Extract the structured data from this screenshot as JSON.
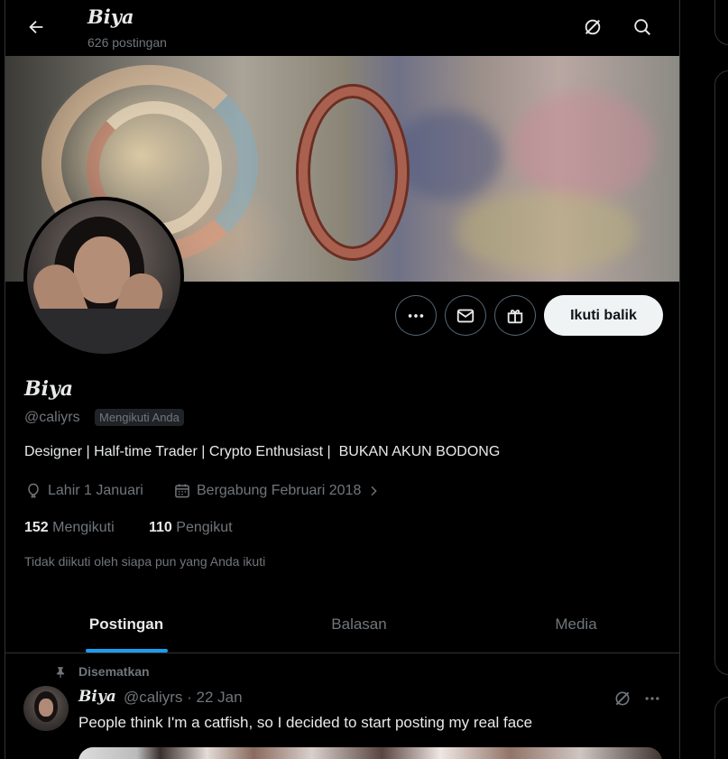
{
  "header": {
    "title": "Biya",
    "post_count": "626 postingan"
  },
  "profile": {
    "name": "Biya",
    "handle": "@caliyrs",
    "follows_you_badge": "Mengikuti Anda",
    "bio": "Designer | Half-time Trader | Crypto Enthusiast |  BUKAN AKUN BODONG",
    "birthday": "Lahir 1 Januari",
    "joined": "Bergabung Februari 2018",
    "following_count": "152",
    "following_label": "Mengikuti",
    "followers_count": "110",
    "followers_label": "Pengikut",
    "not_followed_note": "Tidak diikuti oleh siapa pun yang Anda ikuti"
  },
  "actions": {
    "follow_back_label": "Ikuti balik"
  },
  "tabs": [
    {
      "label": "Postingan",
      "active": true
    },
    {
      "label": "Balasan",
      "active": false
    },
    {
      "label": "Media",
      "active": false
    }
  ],
  "pinned_post": {
    "pinned_label": "Disematkan",
    "author_name": "Biya",
    "author_handle_date": "@caliyrs · 22 Jan",
    "text": "People think I'm a catfish, so I decided to start posting my real face"
  },
  "icons": {
    "back": "arrow-left-icon",
    "grok": "grok-icon",
    "search": "search-icon",
    "more": "more-icon",
    "message": "mail-icon",
    "gift": "gift-icon",
    "birthday": "balloon-icon",
    "calendar": "calendar-icon",
    "pin": "pin-icon"
  },
  "colors": {
    "background": "#000000",
    "text": "#e7e9ea",
    "muted": "#71767b",
    "accent": "#1d9bf0",
    "border": "#2f3336"
  }
}
